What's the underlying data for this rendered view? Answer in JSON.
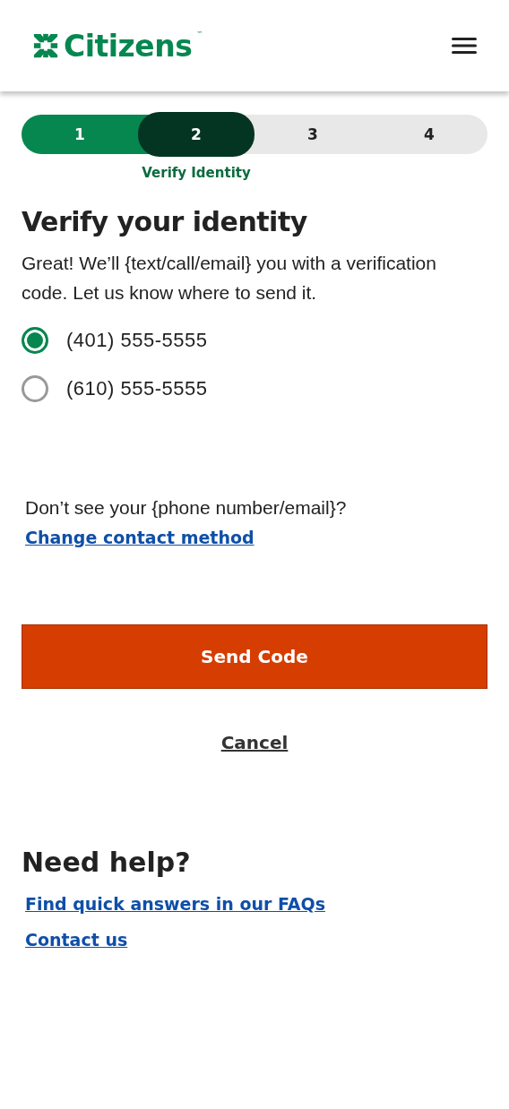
{
  "header": {
    "brand": "Citizens",
    "trademark": "™"
  },
  "steps": [
    {
      "label": "1",
      "completed": true,
      "selected": false
    },
    {
      "label": "2",
      "completed": false,
      "selected": true,
      "caption": "Verify Identity"
    },
    {
      "label": "3",
      "completed": false,
      "selected": false
    },
    {
      "label": "4",
      "completed": false,
      "selected": false
    }
  ],
  "title": "Verify your identity",
  "intro": "Great! We’ll {text/call/email} you with a verification code. Let us know where to send it.",
  "options": [
    {
      "label": "(401) 555-5555",
      "selected": true
    },
    {
      "label": "(610) 555-5555",
      "selected": false
    }
  ],
  "missing": {
    "text": "Don’t see your {phone number/email}?",
    "link": "Change contact method"
  },
  "primary_button": "Send Code",
  "cancel_link": "Cancel",
  "help": {
    "title": "Need help?",
    "links": [
      "Find quick answers in our FAQs",
      "Contact us"
    ]
  }
}
